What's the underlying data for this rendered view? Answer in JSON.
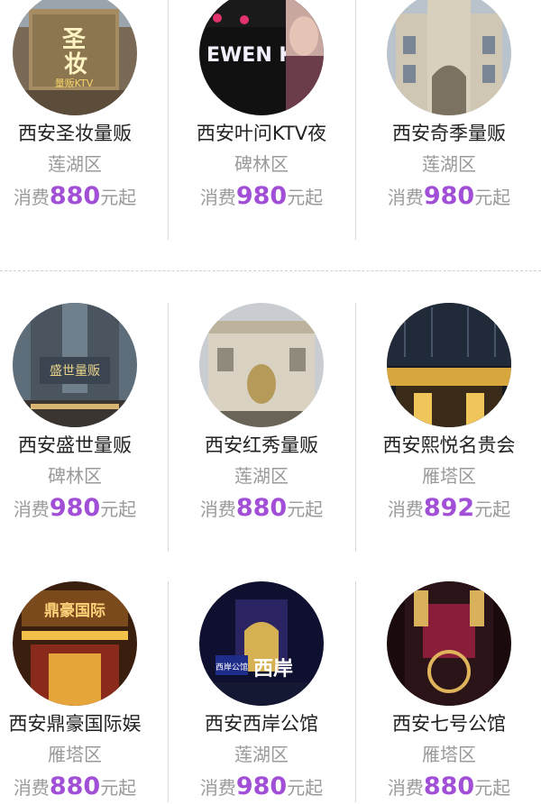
{
  "items": [
    {
      "name": "西安圣妆量贩",
      "district": "莲湖区",
      "price_prefix": "消费",
      "price": "880",
      "price_suffix": "元起",
      "sign_text": "圣\n妆",
      "sub_sign": "量贩KTV"
    },
    {
      "name": "西安叶问KTV夜",
      "district": "碑林区",
      "price_prefix": "消费",
      "price": "980",
      "price_suffix": "元起",
      "sign_text": "EWEN KT",
      "sub_sign": ""
    },
    {
      "name": "西安奇季量贩",
      "district": "莲湖区",
      "price_prefix": "消费",
      "price": "980",
      "price_suffix": "元起",
      "sign_text": "",
      "sub_sign": ""
    },
    {
      "name": "西安盛世量贩",
      "district": "碑林区",
      "price_prefix": "消费",
      "price": "980",
      "price_suffix": "元起",
      "sign_text": "盛世量贩",
      "sub_sign": ""
    },
    {
      "name": "西安红秀量贩",
      "district": "莲湖区",
      "price_prefix": "消费",
      "price": "880",
      "price_suffix": "元起",
      "sign_text": "",
      "sub_sign": ""
    },
    {
      "name": "西安熙悦名贵会",
      "district": "雁塔区",
      "price_prefix": "消费",
      "price": "892",
      "price_suffix": "元起",
      "sign_text": "",
      "sub_sign": ""
    },
    {
      "name": "西安鼎豪国际娱",
      "district": "雁塔区",
      "price_prefix": "消费",
      "price": "880",
      "price_suffix": "元起",
      "sign_text": "鼎豪国际",
      "sub_sign": ""
    },
    {
      "name": "西安西岸公馆",
      "district": "莲湖区",
      "price_prefix": "消费",
      "price": "980",
      "price_suffix": "元起",
      "sign_text": "西岸",
      "sub_sign": "西岸公馆"
    },
    {
      "name": "西安七号公馆",
      "district": "雁塔区",
      "price_prefix": "消费",
      "price": "880",
      "price_suffix": "元起",
      "sign_text": "",
      "sub_sign": ""
    }
  ]
}
